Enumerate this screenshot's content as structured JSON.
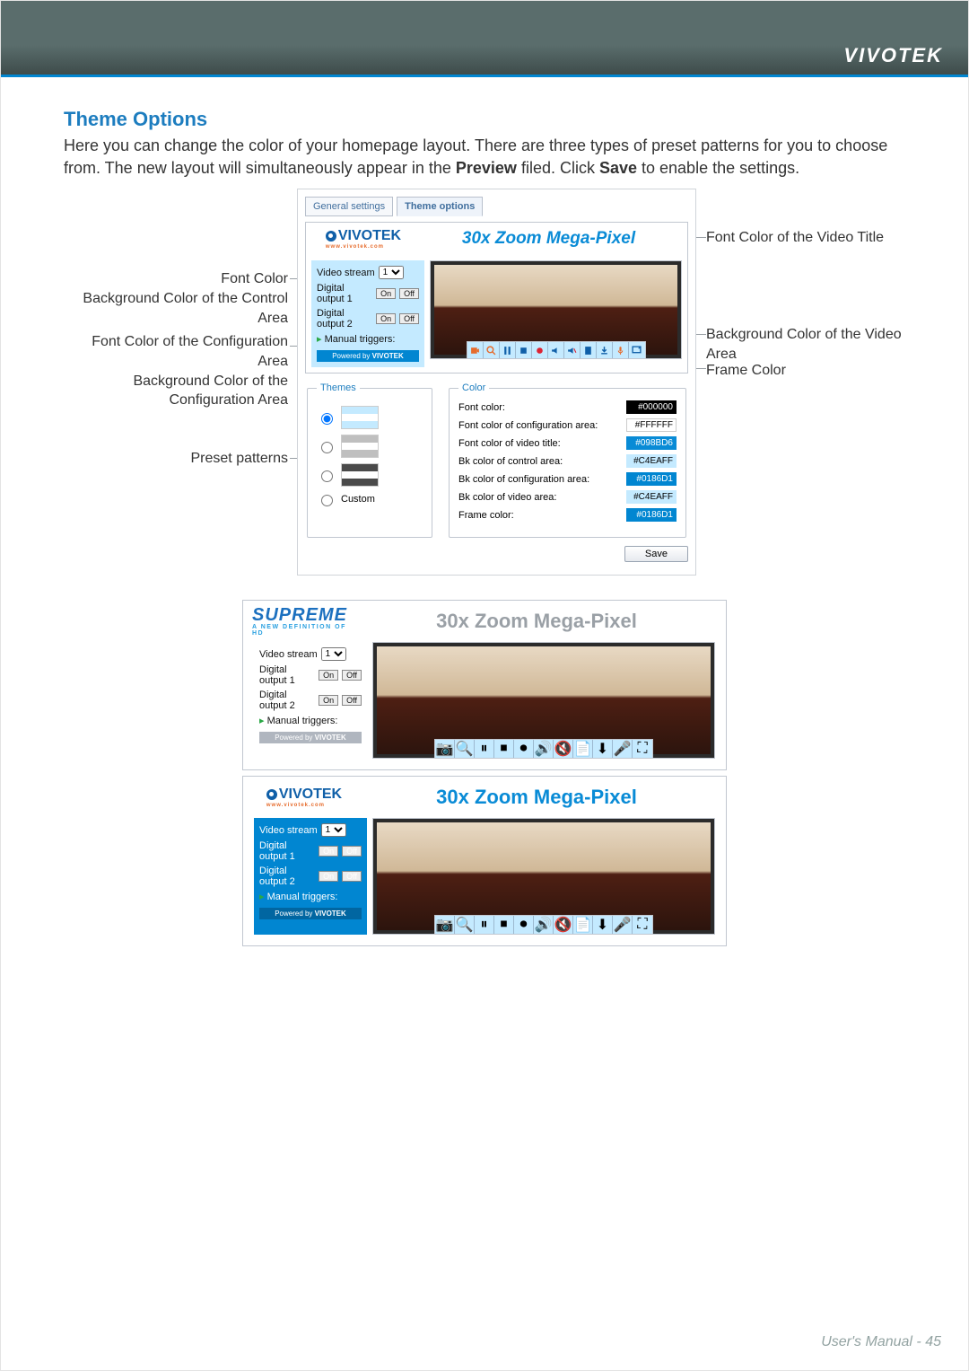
{
  "page": {
    "brand": "VIVOTEK",
    "footer": "User's Manual - 45"
  },
  "section": {
    "title": "Theme Options",
    "p1": "Here you can change the color of your homepage layout. There are three types of preset patterns for you to choose from. The new layout will simultaneously appear in the ",
    "bold1": "Preview",
    "p2": " filed. Click ",
    "bold2": "Save",
    "p3": " to enable the settings."
  },
  "callouts": {
    "left1a": "Font Color",
    "left1b": "Background Color of the Control Area",
    "left2a": "Font Color of the Configuration Area",
    "left2b": "Background Color of the Configuration Area",
    "left3": "Preset patterns",
    "right1": "Font Color of the Video Title",
    "right2": "Background Color of the Video Area",
    "right3": "Frame Color"
  },
  "tabs": {
    "general": "General settings",
    "theme": "Theme options"
  },
  "preview": {
    "logo": "VIVOTEK",
    "logo_sub": "www.vivotek.com",
    "supreme": "SUPREME",
    "supreme_sub": "A NEW DEFINITION OF HD",
    "title": "30x Zoom Mega-Pixel",
    "stream_label": "Video stream",
    "stream_value": "1",
    "dout1": "Digital output 1",
    "dout2": "Digital output 2",
    "btn_on": "On",
    "btn_off": "Off",
    "manual": "Manual triggers:",
    "powered": "Powered by",
    "powered_brand": "VIVOTEK"
  },
  "themes_fs": {
    "legend": "Themes",
    "custom": "Custom"
  },
  "color_fs": {
    "legend": "Color",
    "r1": "Font color:",
    "r2": "Font color of configuration area:",
    "r3": "Font color of video title:",
    "r4": "Bk color of control area:",
    "r5": "Bk color of configuration area:",
    "r6": "Bk color of video area:",
    "r7": "Frame color:",
    "v1": "#000000",
    "v2": "#FFFFFF",
    "v3": "#098BD6",
    "v4": "#C4EAFF",
    "v5": "#0186D1",
    "v6": "#C4EAFF",
    "v7": "#0186D1"
  },
  "buttons": {
    "save": "Save"
  },
  "icons": {
    "camera": "camera-icon",
    "zoom": "zoom-icon",
    "pause": "pause-icon",
    "stop": "stop-icon",
    "record": "record-icon",
    "volume": "volume-icon",
    "mic": "mic-icon",
    "page": "page-icon",
    "download": "download-icon",
    "settings": "settings-icon",
    "fullscreen": "fullscreen-icon"
  }
}
